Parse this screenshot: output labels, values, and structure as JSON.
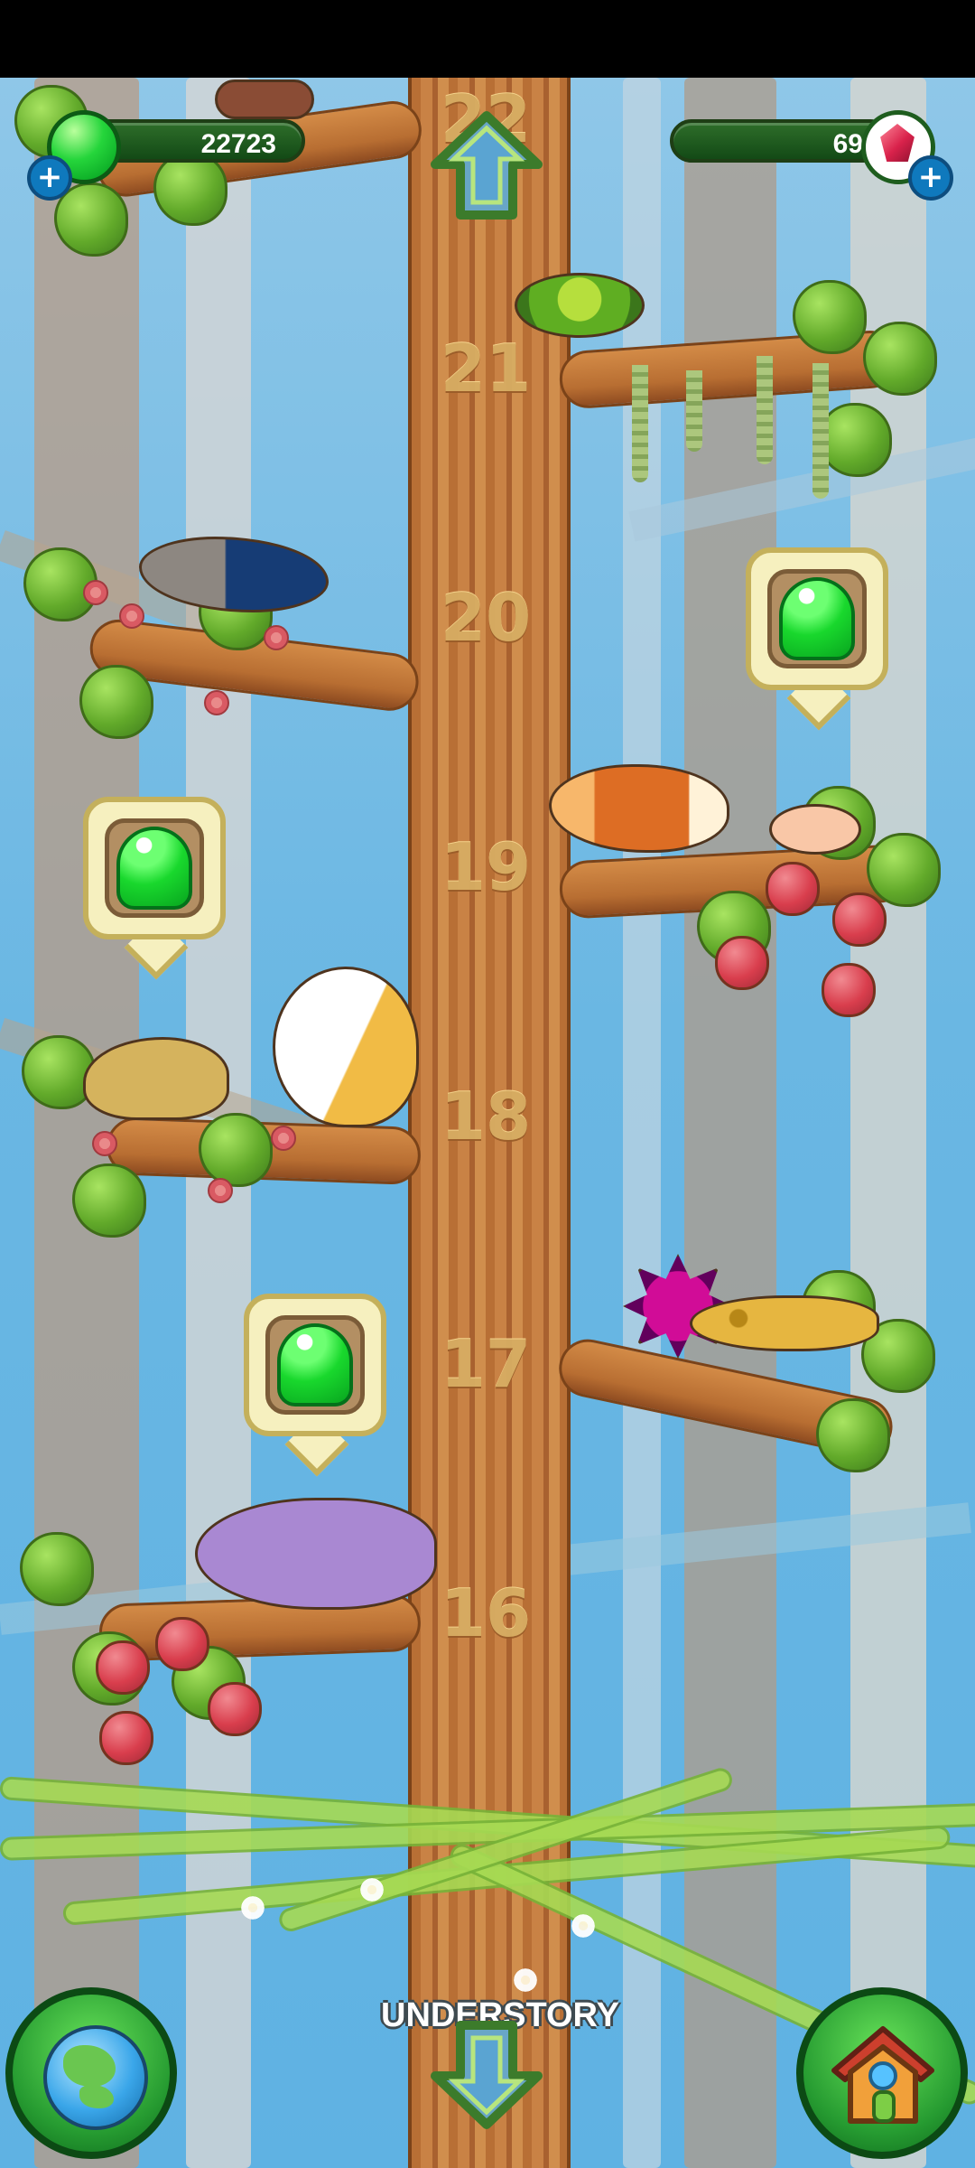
{
  "hud": {
    "coins": "22723",
    "gems": "69",
    "plus_symbol": "+"
  },
  "tree_levels": [
    "22",
    "21",
    "20",
    "19",
    "18",
    "17",
    "16"
  ],
  "region": "UNDERSTORY",
  "colors": {
    "sky": "#6ab7e3",
    "trunk": "#c47d3f",
    "leaf": "#62aa2a",
    "hud_green": "#134a16",
    "jelly_green": "#19d82d"
  },
  "icons": {
    "up_arrow": "up-arrow-icon",
    "down_arrow": "down-arrow-icon",
    "globe": "globe-icon",
    "house": "house-icon",
    "coin": "green-jelly-icon",
    "gem": "red-gem-icon"
  }
}
